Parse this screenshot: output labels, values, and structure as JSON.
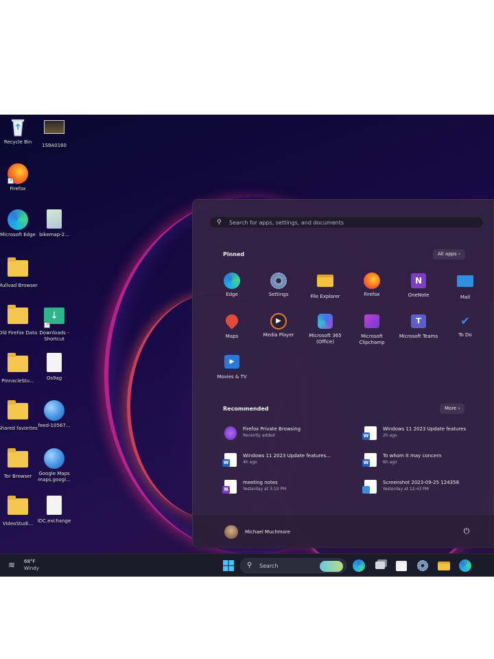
{
  "desktop": {
    "icons": [
      {
        "label": "Recycle Bin"
      },
      {
        "label": "1S9A0160"
      },
      {
        "label": "Firefox"
      },
      {
        "label": "Microsoft Edge"
      },
      {
        "label": "bikemap-2..."
      },
      {
        "label": "Mullvad Browser"
      },
      {
        "label": "Old Firefox Data"
      },
      {
        "label": "Downloads - Shortcut"
      },
      {
        "label": "PinnacleStu..."
      },
      {
        "label": "Os9ag"
      },
      {
        "label": "Shared favorites"
      },
      {
        "label": "feed-10567..."
      },
      {
        "label": "Tor Browser"
      },
      {
        "label": "Google Maps maps.googl..."
      },
      {
        "label": "VideoStudi..."
      },
      {
        "label": "IDC.exchange"
      }
    ]
  },
  "start_menu": {
    "search_placeholder": "Search for apps, settings, and documents",
    "pinned_title": "Pinned",
    "all_apps_label": "All apps",
    "pinned": [
      {
        "label": "Edge",
        "icon": "edge-icon"
      },
      {
        "label": "Settings",
        "icon": "gear-icon"
      },
      {
        "label": "File Explorer",
        "icon": "folder-icon"
      },
      {
        "label": "Firefox",
        "icon": "firefox-icon"
      },
      {
        "label": "OneNote",
        "icon": "onenote-icon"
      },
      {
        "label": "Mail",
        "icon": "mail-icon"
      },
      {
        "label": "Maps",
        "icon": "map-pin-icon"
      },
      {
        "label": "Media Player",
        "icon": "play-icon"
      },
      {
        "label": "Microsoft 365 (Office)",
        "icon": "office-icon"
      },
      {
        "label": "Microsoft Clipchamp",
        "icon": "clipchamp-icon"
      },
      {
        "label": "Microsoft Teams",
        "icon": "teams-icon"
      },
      {
        "label": "To Do",
        "icon": "checkmark-icon"
      },
      {
        "label": "Movies & TV",
        "icon": "movies-icon"
      }
    ],
    "recommended_title": "Recommended",
    "more_label": "More",
    "recommended": [
      {
        "title": "Firefox Private Browsing",
        "sub": "Recently added"
      },
      {
        "title": "Windows 11 2023 Update features",
        "sub": "2h ago"
      },
      {
        "title": "Windows 11 2023 Update features...",
        "sub": "4h ago"
      },
      {
        "title": "To whom it may concern",
        "sub": "6h ago"
      },
      {
        "title": "meeting notes",
        "sub": "Yesterday at 3:10 PM"
      },
      {
        "title": "Screenshot 2023-09-25 124358",
        "sub": "Yesterday at 12:43 PM"
      }
    ],
    "user_name": "Michael Muchmore"
  },
  "taskbar": {
    "weather_temp": "68°F",
    "weather_cond": "Windy",
    "search_label": "Search"
  },
  "colors": {
    "start_bg": "#34244a",
    "taskbar_bg": "#1c1b2a",
    "accent_blue": "#3d8de0"
  }
}
